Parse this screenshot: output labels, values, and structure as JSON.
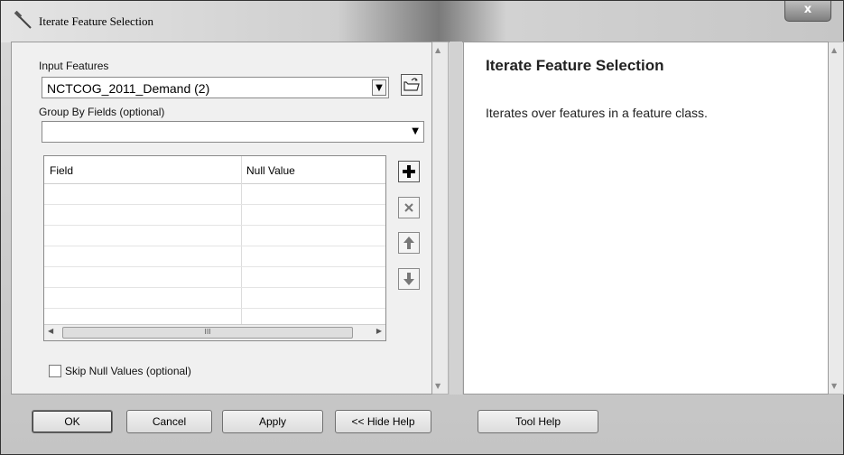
{
  "window": {
    "title": "Iterate Feature Selection",
    "close_label": "x"
  },
  "form": {
    "input_features_label": "Input Features",
    "input_features_value": "NCTCOG_2011_Demand (2)",
    "group_by_label": "Group By Fields (optional)",
    "group_by_value": "",
    "table": {
      "columns": [
        "Field",
        "Null Value"
      ],
      "rows": []
    },
    "skip_null_label": "Skip Null Values (optional)",
    "skip_null_checked": false
  },
  "help": {
    "title": "Iterate Feature Selection",
    "description": "Iterates over features in a feature class."
  },
  "buttons": {
    "ok": "OK",
    "cancel": "Cancel",
    "apply": "Apply",
    "hide_help": "<< Hide Help",
    "tool_help": "Tool Help"
  },
  "icons": {
    "title": "hammer-icon",
    "browse": "folder-open-icon",
    "add": "plus-icon",
    "remove": "x-icon",
    "up": "arrow-up-icon",
    "down": "arrow-down-icon"
  }
}
